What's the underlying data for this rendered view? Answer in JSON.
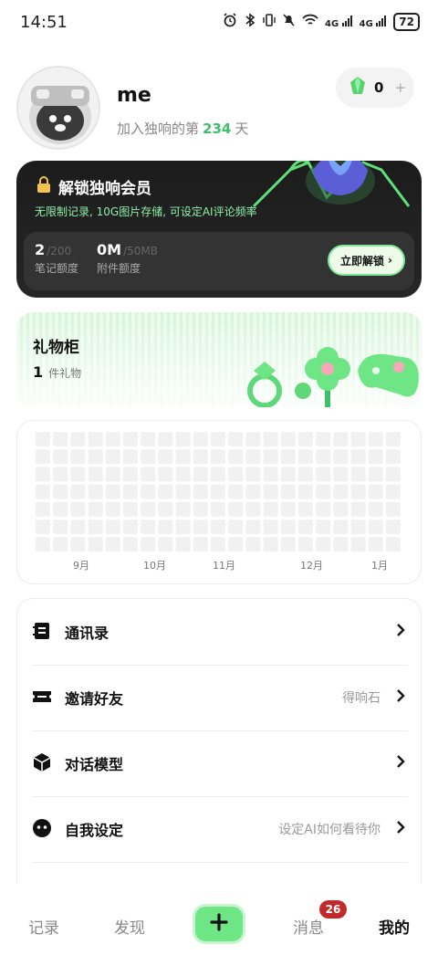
{
  "status_bar": {
    "time": "14:51",
    "network_1": "4G",
    "network_2": "4G",
    "battery": "72"
  },
  "profile": {
    "username": "me",
    "joined_prefix": "加入独响的第",
    "joined_days": "234",
    "joined_suffix": "天",
    "gem_count": "0",
    "gem_plus": "+"
  },
  "vip": {
    "title": "解锁独响会员",
    "description": "无限制记录, 10G图片存储, 可设定AI评论频率",
    "notes_used": "2",
    "notes_max": "/200",
    "notes_label": "笔记额度",
    "attach_used": "0M",
    "attach_max": "/50MB",
    "attach_label": "附件额度",
    "unlock_label": "立即解锁",
    "unlock_chevron": "›"
  },
  "gift": {
    "title": "礼物柜",
    "count": "1",
    "count_suffix": "件礼物"
  },
  "heatmap": {
    "months": [
      "9月",
      "10月",
      "11月",
      "12月",
      "1月"
    ]
  },
  "menu": {
    "items": [
      {
        "label": "通讯录",
        "hint": ""
      },
      {
        "label": "邀请好友",
        "hint": "得响石"
      },
      {
        "label": "对话模型",
        "hint": ""
      },
      {
        "label": "自我设定",
        "hint": "设定AI如何看待你"
      }
    ]
  },
  "nav": {
    "record": "记录",
    "discover": "发现",
    "messages": "消息",
    "messages_badge": "26",
    "mine": "我的"
  },
  "colors": {
    "accent_green": "#6ee685",
    "days_green": "#3fbf6a",
    "vip_desc_green": "#8ef0a9",
    "badge_red": "#c12a2a",
    "vip_bg": "#1c1c1c"
  },
  "icons": [
    "alarm-icon",
    "bluetooth-icon",
    "vibrate-icon",
    "mute-icon",
    "wifi-icon",
    "signal-icon",
    "battery-icon",
    "gem-icon",
    "lock-icon",
    "crown-icon",
    "flower-icon",
    "ring-icon",
    "gamepad-icon",
    "contacts-icon",
    "ticket-icon",
    "cube-icon",
    "face-icon",
    "chevron-right-icon",
    "plus-icon"
  ]
}
